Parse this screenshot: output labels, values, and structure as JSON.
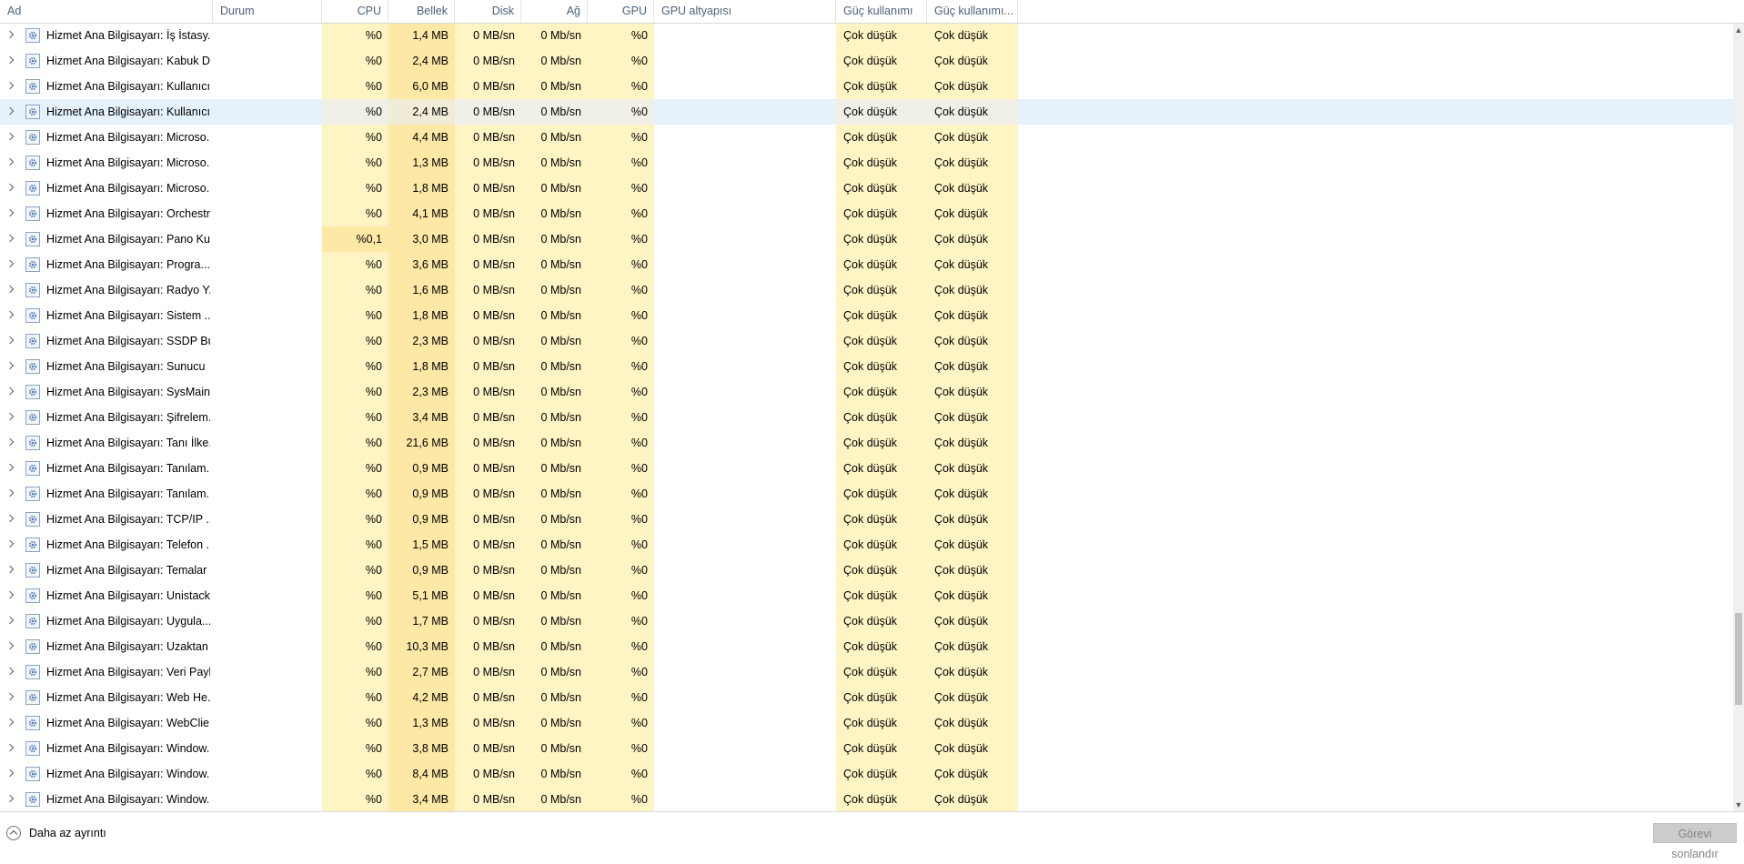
{
  "columns": {
    "name": "Ad",
    "status": "Durum",
    "cpu": "CPU",
    "memory": "Bellek",
    "disk": "Disk",
    "network": "Ağ",
    "gpu": "GPU",
    "gpu_engine": "GPU altyapısı",
    "power_usage": "Güç kullanımı",
    "power_trend": "Güç kullanımı..."
  },
  "processes": [
    {
      "name": "Hizmet Ana Bilgisayarı: İş İstasy...",
      "cpu": "%0",
      "memory": "1,4 MB",
      "disk": "0 MB/sn",
      "network": "0 Mb/sn",
      "gpu": "%0",
      "power": "Çok düşük",
      "power_trend": "Çok düşük"
    },
    {
      "name": "Hizmet Ana Bilgisayarı: Kabuk D...",
      "cpu": "%0",
      "memory": "2,4 MB",
      "disk": "0 MB/sn",
      "network": "0 Mb/sn",
      "gpu": "%0",
      "power": "Çok düşük",
      "power_trend": "Çok düşük"
    },
    {
      "name": "Hizmet Ana Bilgisayarı: Kullanıcı...",
      "cpu": "%0",
      "memory": "6,0 MB",
      "disk": "0 MB/sn",
      "network": "0 Mb/sn",
      "gpu": "%0",
      "power": "Çok düşük",
      "power_trend": "Çok düşük"
    },
    {
      "name": "Hizmet Ana Bilgisayarı: Kullanıcı...",
      "cpu": "%0",
      "memory": "2,4 MB",
      "disk": "0 MB/sn",
      "network": "0 Mb/sn",
      "gpu": "%0",
      "power": "Çok düşük",
      "power_trend": "Çok düşük",
      "selected": true
    },
    {
      "name": "Hizmet Ana Bilgisayarı: Microso...",
      "cpu": "%0",
      "memory": "4,4 MB",
      "disk": "0 MB/sn",
      "network": "0 Mb/sn",
      "gpu": "%0",
      "power": "Çok düşük",
      "power_trend": "Çok düşük"
    },
    {
      "name": "Hizmet Ana Bilgisayarı: Microso...",
      "cpu": "%0",
      "memory": "1,3 MB",
      "disk": "0 MB/sn",
      "network": "0 Mb/sn",
      "gpu": "%0",
      "power": "Çok düşük",
      "power_trend": "Çok düşük"
    },
    {
      "name": "Hizmet Ana Bilgisayarı: Microso...",
      "cpu": "%0",
      "memory": "1,8 MB",
      "disk": "0 MB/sn",
      "network": "0 Mb/sn",
      "gpu": "%0",
      "power": "Çok düşük",
      "power_trend": "Çok düşük"
    },
    {
      "name": "Hizmet Ana Bilgisayarı: Orchestr...",
      "cpu": "%0",
      "memory": "4,1 MB",
      "disk": "0 MB/sn",
      "network": "0 Mb/sn",
      "gpu": "%0",
      "power": "Çok düşük",
      "power_trend": "Çok düşük"
    },
    {
      "name": "Hizmet Ana Bilgisayarı: Pano Ku...",
      "cpu": "%0,1",
      "memory": "3,0 MB",
      "disk": "0 MB/sn",
      "network": "0 Mb/sn",
      "gpu": "%0",
      "power": "Çok düşük",
      "power_trend": "Çok düşük"
    },
    {
      "name": "Hizmet Ana Bilgisayarı: Progra...",
      "cpu": "%0",
      "memory": "3,6 MB",
      "disk": "0 MB/sn",
      "network": "0 Mb/sn",
      "gpu": "%0",
      "power": "Çok düşük",
      "power_trend": "Çok düşük"
    },
    {
      "name": "Hizmet Ana Bilgisayarı: Radyo Y...",
      "cpu": "%0",
      "memory": "1,6 MB",
      "disk": "0 MB/sn",
      "network": "0 Mb/sn",
      "gpu": "%0",
      "power": "Çok düşük",
      "power_trend": "Çok düşük"
    },
    {
      "name": "Hizmet Ana Bilgisayarı: Sistem ...",
      "cpu": "%0",
      "memory": "1,8 MB",
      "disk": "0 MB/sn",
      "network": "0 Mb/sn",
      "gpu": "%0",
      "power": "Çok düşük",
      "power_trend": "Çok düşük"
    },
    {
      "name": "Hizmet Ana Bilgisayarı: SSDP Bu...",
      "cpu": "%0",
      "memory": "2,3 MB",
      "disk": "0 MB/sn",
      "network": "0 Mb/sn",
      "gpu": "%0",
      "power": "Çok düşük",
      "power_trend": "Çok düşük"
    },
    {
      "name": "Hizmet Ana Bilgisayarı: Sunucu",
      "cpu": "%0",
      "memory": "1,8 MB",
      "disk": "0 MB/sn",
      "network": "0 Mb/sn",
      "gpu": "%0",
      "power": "Çok düşük",
      "power_trend": "Çok düşük"
    },
    {
      "name": "Hizmet Ana Bilgisayarı: SysMain",
      "cpu": "%0",
      "memory": "2,3 MB",
      "disk": "0 MB/sn",
      "network": "0 Mb/sn",
      "gpu": "%0",
      "power": "Çok düşük",
      "power_trend": "Çok düşük"
    },
    {
      "name": "Hizmet Ana Bilgisayarı: Şifrelem...",
      "cpu": "%0",
      "memory": "3,4 MB",
      "disk": "0 MB/sn",
      "network": "0 Mb/sn",
      "gpu": "%0",
      "power": "Çok düşük",
      "power_trend": "Çok düşük"
    },
    {
      "name": "Hizmet Ana Bilgisayarı: Tanı İlke...",
      "cpu": "%0",
      "memory": "21,6 MB",
      "disk": "0 MB/sn",
      "network": "0 Mb/sn",
      "gpu": "%0",
      "power": "Çok düşük",
      "power_trend": "Çok düşük"
    },
    {
      "name": "Hizmet Ana Bilgisayarı: Tanılam...",
      "cpu": "%0",
      "memory": "0,9 MB",
      "disk": "0 MB/sn",
      "network": "0 Mb/sn",
      "gpu": "%0",
      "power": "Çok düşük",
      "power_trend": "Çok düşük"
    },
    {
      "name": "Hizmet Ana Bilgisayarı: Tanılam...",
      "cpu": "%0",
      "memory": "0,9 MB",
      "disk": "0 MB/sn",
      "network": "0 Mb/sn",
      "gpu": "%0",
      "power": "Çok düşük",
      "power_trend": "Çok düşük"
    },
    {
      "name": "Hizmet Ana Bilgisayarı: TCP/IP ...",
      "cpu": "%0",
      "memory": "0,9 MB",
      "disk": "0 MB/sn",
      "network": "0 Mb/sn",
      "gpu": "%0",
      "power": "Çok düşük",
      "power_trend": "Çok düşük"
    },
    {
      "name": "Hizmet Ana Bilgisayarı: Telefon ...",
      "cpu": "%0",
      "memory": "1,5 MB",
      "disk": "0 MB/sn",
      "network": "0 Mb/sn",
      "gpu": "%0",
      "power": "Çok düşük",
      "power_trend": "Çok düşük"
    },
    {
      "name": "Hizmet Ana Bilgisayarı: Temalar",
      "cpu": "%0",
      "memory": "0,9 MB",
      "disk": "0 MB/sn",
      "network": "0 Mb/sn",
      "gpu": "%0",
      "power": "Çok düşük",
      "power_trend": "Çok düşük"
    },
    {
      "name": "Hizmet Ana Bilgisayarı: Unistack...",
      "cpu": "%0",
      "memory": "5,1 MB",
      "disk": "0 MB/sn",
      "network": "0 Mb/sn",
      "gpu": "%0",
      "power": "Çok düşük",
      "power_trend": "Çok düşük"
    },
    {
      "name": "Hizmet Ana Bilgisayarı: Uygula...",
      "cpu": "%0",
      "memory": "1,7 MB",
      "disk": "0 MB/sn",
      "network": "0 Mb/sn",
      "gpu": "%0",
      "power": "Çok düşük",
      "power_trend": "Çok düşük"
    },
    {
      "name": "Hizmet Ana Bilgisayarı: Uzaktan ...",
      "cpu": "%0",
      "memory": "10,3 MB",
      "disk": "0 MB/sn",
      "network": "0 Mb/sn",
      "gpu": "%0",
      "power": "Çok düşük",
      "power_trend": "Çok düşük"
    },
    {
      "name": "Hizmet Ana Bilgisayarı: Veri Payl...",
      "cpu": "%0",
      "memory": "2,7 MB",
      "disk": "0 MB/sn",
      "network": "0 Mb/sn",
      "gpu": "%0",
      "power": "Çok düşük",
      "power_trend": "Çok düşük"
    },
    {
      "name": "Hizmet Ana Bilgisayarı: Web He...",
      "cpu": "%0",
      "memory": "4,2 MB",
      "disk": "0 MB/sn",
      "network": "0 Mb/sn",
      "gpu": "%0",
      "power": "Çok düşük",
      "power_trend": "Çok düşük"
    },
    {
      "name": "Hizmet Ana Bilgisayarı: WebClie...",
      "cpu": "%0",
      "memory": "1,3 MB",
      "disk": "0 MB/sn",
      "network": "0 Mb/sn",
      "gpu": "%0",
      "power": "Çok düşük",
      "power_trend": "Çok düşük"
    },
    {
      "name": "Hizmet Ana Bilgisayarı: Window...",
      "cpu": "%0",
      "memory": "3,8 MB",
      "disk": "0 MB/sn",
      "network": "0 Mb/sn",
      "gpu": "%0",
      "power": "Çok düşük",
      "power_trend": "Çok düşük"
    },
    {
      "name": "Hizmet Ana Bilgisayarı: Window...",
      "cpu": "%0",
      "memory": "8,4 MB",
      "disk": "0 MB/sn",
      "network": "0 Mb/sn",
      "gpu": "%0",
      "power": "Çok düşük",
      "power_trend": "Çok düşük"
    },
    {
      "name": "Hizmet Ana Bilgisayarı: Window...",
      "cpu": "%0",
      "memory": "3,4 MB",
      "disk": "0 MB/sn",
      "network": "0 Mb/sn",
      "gpu": "%0",
      "power": "Çok düşük",
      "power_trend": "Çok düşük"
    }
  ],
  "icons": {
    "expand": "chevron-right-icon",
    "process": "gear-icon",
    "less_details": "chevron-up-circle-icon"
  },
  "scrollbar": {
    "position_fraction": 0.86,
    "visible_fraction": 0.12
  },
  "footer": {
    "less_details_label": "Daha az ayrıntı",
    "end_task_label": "Görevi sonlandır"
  },
  "colors": {
    "header_text": "#4c607a",
    "heat_light": "#fff4c4",
    "heat_medium": "#fde8a6",
    "selection": "#e5f1fb"
  }
}
